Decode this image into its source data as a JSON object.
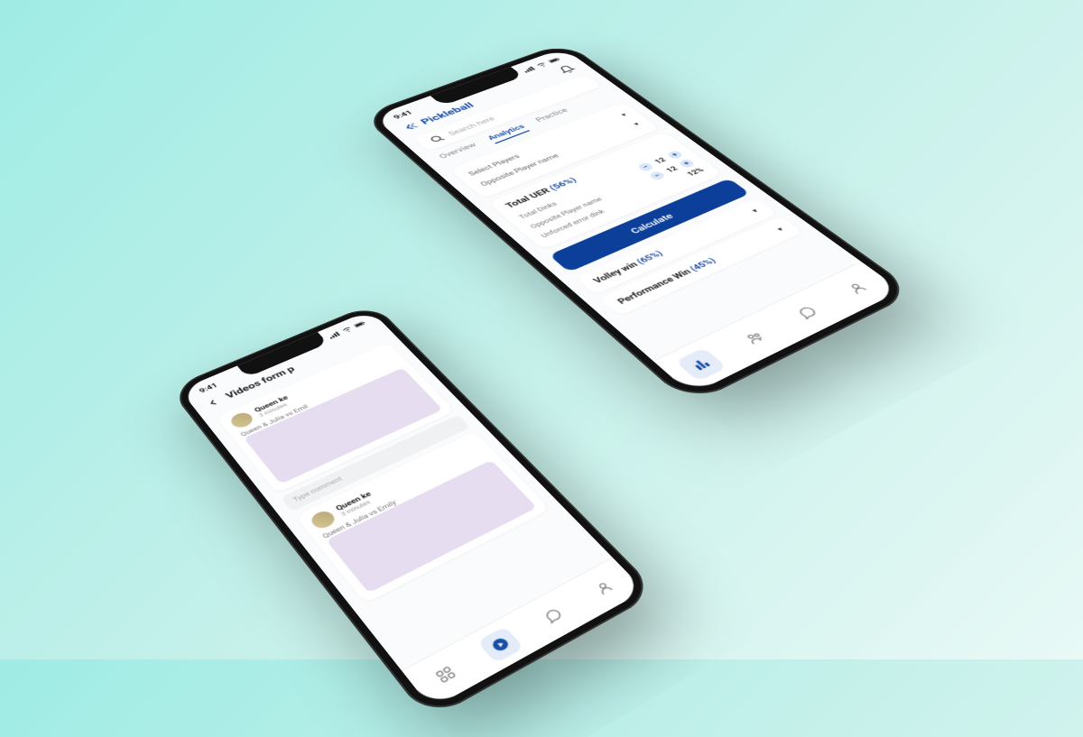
{
  "status": {
    "time": "9:41"
  },
  "brand": {
    "name": "Pickleball"
  },
  "search": {
    "placeholder": "Search here"
  },
  "tabs": {
    "overview": "Overview",
    "analytics": "Analytics",
    "practice": "Practice"
  },
  "selectors": {
    "select_players": "Select Players",
    "opposite_player": "Opposite Player name"
  },
  "total_uer": {
    "title": "Total UER",
    "pct": "(56%)",
    "total_dinks": {
      "label": "Total Dinks",
      "value": "12"
    },
    "opposite": {
      "label": "Opposite Player name",
      "value": "12"
    },
    "unforced": {
      "label": "Unforced error dink",
      "pct": "12%"
    }
  },
  "calculate": "Calculate",
  "metrics": {
    "volley": {
      "label": "Volley win",
      "pct": "(65%)"
    },
    "performance": {
      "label": "Performance Win",
      "pct": "(45%)"
    }
  },
  "videos_page": {
    "title": "Videos form p",
    "item1": {
      "user": "Queen ke",
      "time": "3 minutes",
      "title": "Queen & Julia vs Emil"
    },
    "item2": {
      "user": "Queen ke",
      "time": "3 minutes",
      "title": "Queen & Julia vs Emily"
    },
    "comment_placeholder": "Type comment"
  }
}
